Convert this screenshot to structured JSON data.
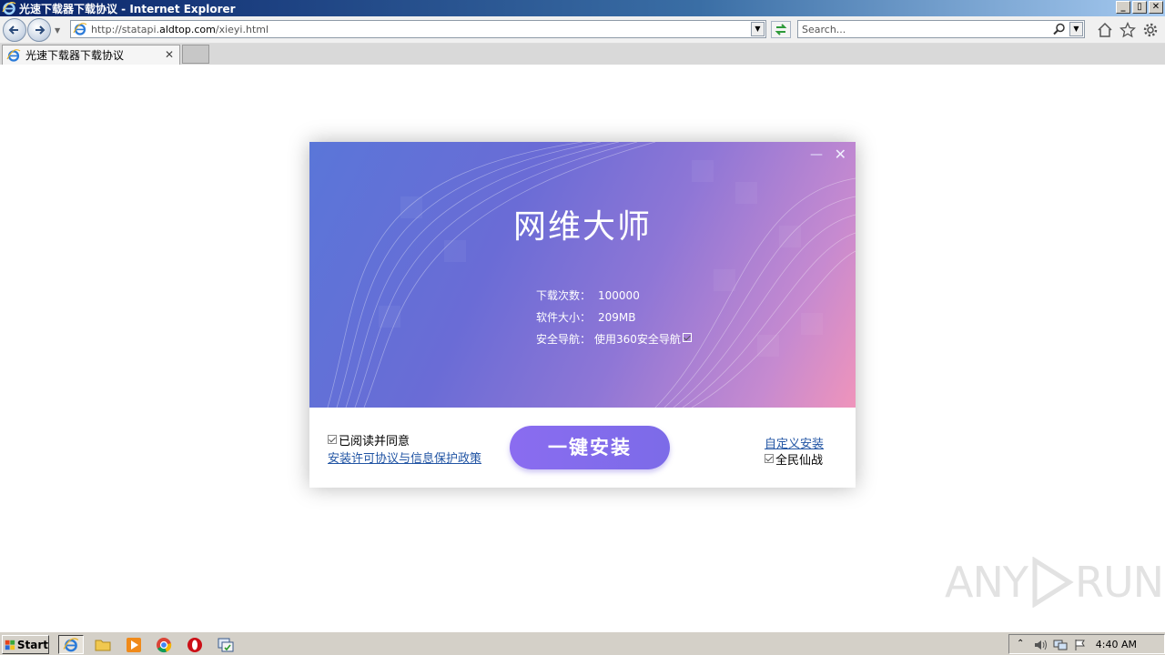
{
  "window": {
    "title": "光速下载器下载协议 - Internet Explorer",
    "buttons": [
      "_",
      "▯",
      "✕"
    ]
  },
  "navbar": {
    "address_prefix": "http://statapi.",
    "address_domain": "aldtop.com",
    "address_path": "/xieyi.html",
    "search_placeholder": "Search..."
  },
  "tabs": [
    {
      "label": "光速下载器下载协议",
      "close": "✕"
    }
  ],
  "dialog": {
    "app_name": "网维大师",
    "info": [
      {
        "key": "下载次数：",
        "value": "100000"
      },
      {
        "key": "软件大小：",
        "value": "209MB"
      },
      {
        "key": "安全导航：",
        "value": "使用360安全导航"
      }
    ],
    "agree_label": "已阅读并同意",
    "policy_link": "安装许可协议与信息保护政策",
    "install_button": "一键安装",
    "custom_install": "自定义安装",
    "bundle_label": "全民仙战",
    "minimize": "—",
    "close": "✕",
    "colors": {
      "gradient_start": "#5a76d8",
      "gradient_end": "#ef94bb",
      "button": "#8a6cf0",
      "link": "#2255a4"
    }
  },
  "watermark": {
    "text_left": "ANY",
    "text_right": "RUN"
  },
  "taskbar": {
    "start_label": "Start",
    "clock": "4:40 AM",
    "pinned": [
      "ie-icon",
      "explorer-icon",
      "media-player-icon",
      "chrome-icon",
      "opera-icon",
      "task-icon"
    ]
  }
}
